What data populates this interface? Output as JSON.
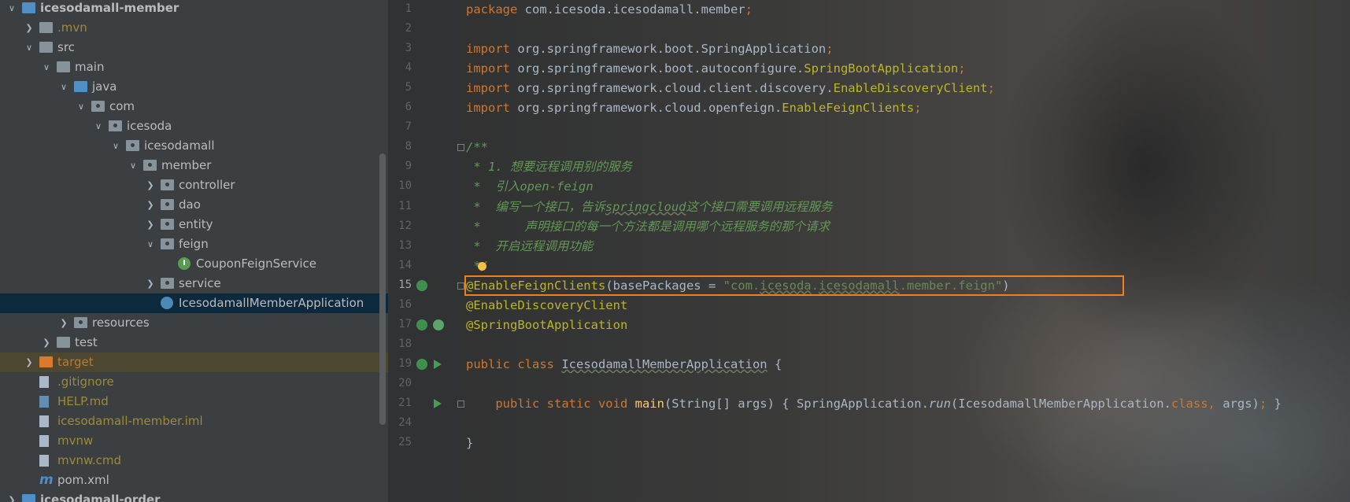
{
  "tree": [
    {
      "label": "icesodamall-member",
      "indent": 0,
      "arrow": "open",
      "icon": "module-folder-icon",
      "bold": true
    },
    {
      "label": ".mvn",
      "indent": 1,
      "arrow": "closed",
      "icon": "folder-icon",
      "ignored": true
    },
    {
      "label": "src",
      "indent": 1,
      "arrow": "open",
      "icon": "folder-icon"
    },
    {
      "label": "main",
      "indent": 2,
      "arrow": "open",
      "icon": "folder-icon"
    },
    {
      "label": "java",
      "indent": 3,
      "arrow": "open",
      "icon": "source-folder-icon"
    },
    {
      "label": "com",
      "indent": 4,
      "arrow": "open",
      "icon": "package-icon"
    },
    {
      "label": "icesoda",
      "indent": 5,
      "arrow": "open",
      "icon": "package-icon"
    },
    {
      "label": "icesodamall",
      "indent": 6,
      "arrow": "open",
      "icon": "package-icon"
    },
    {
      "label": "member",
      "indent": 7,
      "arrow": "open",
      "icon": "package-icon"
    },
    {
      "label": "controller",
      "indent": 8,
      "arrow": "closed",
      "icon": "package-icon"
    },
    {
      "label": "dao",
      "indent": 8,
      "arrow": "closed",
      "icon": "package-icon"
    },
    {
      "label": "entity",
      "indent": 8,
      "arrow": "closed",
      "icon": "package-icon"
    },
    {
      "label": "feign",
      "indent": 8,
      "arrow": "open",
      "icon": "package-icon"
    },
    {
      "label": "CouponFeignService",
      "indent": 9,
      "arrow": "none",
      "icon": "interface-icon"
    },
    {
      "label": "service",
      "indent": 8,
      "arrow": "closed",
      "icon": "package-icon"
    },
    {
      "label": "IcesodamallMemberApplication",
      "indent": 8,
      "arrow": "none",
      "icon": "spring-boot-class-icon",
      "selected": true
    },
    {
      "label": "resources",
      "indent": 3,
      "arrow": "closed",
      "icon": "resources-folder-icon"
    },
    {
      "label": "test",
      "indent": 2,
      "arrow": "closed",
      "icon": "folder-icon"
    },
    {
      "label": "target",
      "indent": 1,
      "arrow": "closed",
      "icon": "excluded-folder-icon",
      "ignored": true,
      "highlighted": true
    },
    {
      "label": ".gitignore",
      "indent": 1,
      "arrow": "none",
      "icon": "file-icon",
      "ignored": true
    },
    {
      "label": "HELP.md",
      "indent": 1,
      "arrow": "none",
      "icon": "markdown-icon",
      "ignored": true
    },
    {
      "label": "icesodamall-member.iml",
      "indent": 1,
      "arrow": "none",
      "icon": "iml-file-icon",
      "ignored": true
    },
    {
      "label": "mvnw",
      "indent": 1,
      "arrow": "none",
      "icon": "file-icon",
      "ignored": true
    },
    {
      "label": "mvnw.cmd",
      "indent": 1,
      "arrow": "none",
      "icon": "file-icon",
      "ignored": true
    },
    {
      "label": "pom.xml",
      "indent": 1,
      "arrow": "none",
      "icon": "maven-icon"
    },
    {
      "label": "icesodamall-order",
      "indent": 0,
      "arrow": "closed",
      "icon": "module-folder-icon",
      "bold": true
    }
  ],
  "editor": {
    "current_line": "15",
    "lines": [
      {
        "n": "1",
        "tokens": [
          [
            "kw",
            "package "
          ],
          [
            "",
            "com.icesoda.icesodamall.member"
          ],
          [
            "kw",
            ";"
          ]
        ]
      },
      {
        "n": "2",
        "tokens": []
      },
      {
        "n": "3",
        "tokens": [
          [
            "kw",
            "import "
          ],
          [
            "",
            "org.springframework.boot.SpringApplication"
          ],
          [
            "kw",
            ";"
          ]
        ]
      },
      {
        "n": "4",
        "tokens": [
          [
            "kw",
            "import "
          ],
          [
            "",
            "org.springframework.boot.autoconfigure."
          ],
          [
            "ann",
            "SpringBootApplication"
          ],
          [
            "kw",
            ";"
          ]
        ]
      },
      {
        "n": "5",
        "tokens": [
          [
            "kw",
            "import "
          ],
          [
            "",
            "org.springframework.cloud.client.discovery."
          ],
          [
            "ann",
            "EnableDiscoveryClient"
          ],
          [
            "kw",
            ";"
          ]
        ]
      },
      {
        "n": "6",
        "tokens": [
          [
            "kw",
            "import "
          ],
          [
            "",
            "org.springframework.cloud.openfeign."
          ],
          [
            "ann",
            "EnableFeignClients"
          ],
          [
            "kw",
            ";"
          ]
        ]
      },
      {
        "n": "7",
        "tokens": []
      },
      {
        "n": "8",
        "tokens": [
          [
            "cmt",
            "/**"
          ]
        ]
      },
      {
        "n": "9",
        "tokens": [
          [
            "cmt",
            " * 1. 想要远程调用别的服务"
          ]
        ]
      },
      {
        "n": "10",
        "tokens": [
          [
            "cmt",
            " *  引入open-feign"
          ]
        ]
      },
      {
        "n": "11",
        "tokens": [
          [
            "cmt",
            " *  编写一个接口，告诉"
          ],
          [
            "cmt uline",
            "springcloud"
          ],
          [
            "cmt",
            "这个接口需要调用远程服务"
          ]
        ]
      },
      {
        "n": "12",
        "tokens": [
          [
            "cmt",
            " *      声明接口的每一个方法都是调用哪个远程服务的那个请求"
          ]
        ]
      },
      {
        "n": "13",
        "tokens": [
          [
            "cmt",
            " *  开启远程调用功能"
          ]
        ]
      },
      {
        "n": "14",
        "tokens": [
          [
            "cmt",
            " */"
          ]
        ]
      },
      {
        "n": "15",
        "tokens": [
          [
            "ann",
            "@EnableFeignClients"
          ],
          [
            "",
            "(basePackages = "
          ],
          [
            "str",
            "\"com."
          ],
          [
            "str uline",
            "icesoda"
          ],
          [
            "str",
            "."
          ],
          [
            "str uline",
            "icesodamall"
          ],
          [
            "str",
            ".member.feign\""
          ],
          [
            "",
            ")"
          ]
        ]
      },
      {
        "n": "16",
        "tokens": [
          [
            "ann",
            "@EnableDiscoveryClient"
          ]
        ]
      },
      {
        "n": "17",
        "tokens": [
          [
            "ann",
            "@SpringBootApplication"
          ]
        ]
      },
      {
        "n": "18",
        "tokens": []
      },
      {
        "n": "19",
        "tokens": [
          [
            "kw",
            "public class "
          ],
          [
            "uline",
            "IcesodamallMemberApplication"
          ],
          [
            "",
            " {"
          ]
        ]
      },
      {
        "n": "20",
        "tokens": []
      },
      {
        "n": "21",
        "tokens": [
          [
            "",
            "    "
          ],
          [
            "kw",
            "public static void "
          ],
          [
            "fn",
            "main"
          ],
          [
            "",
            "(String[] args) { SpringApplication."
          ],
          [
            "it",
            "run"
          ],
          [
            "",
            "(IcesodamallMemberApplication."
          ],
          [
            "kw",
            "class, "
          ],
          [
            "",
            "args)"
          ],
          [
            "kw",
            ";"
          ],
          [
            "",
            " }"
          ]
        ]
      },
      {
        "n": "24",
        "tokens": []
      },
      {
        "n": "25",
        "tokens": [
          [
            "",
            "}"
          ]
        ]
      }
    ]
  }
}
